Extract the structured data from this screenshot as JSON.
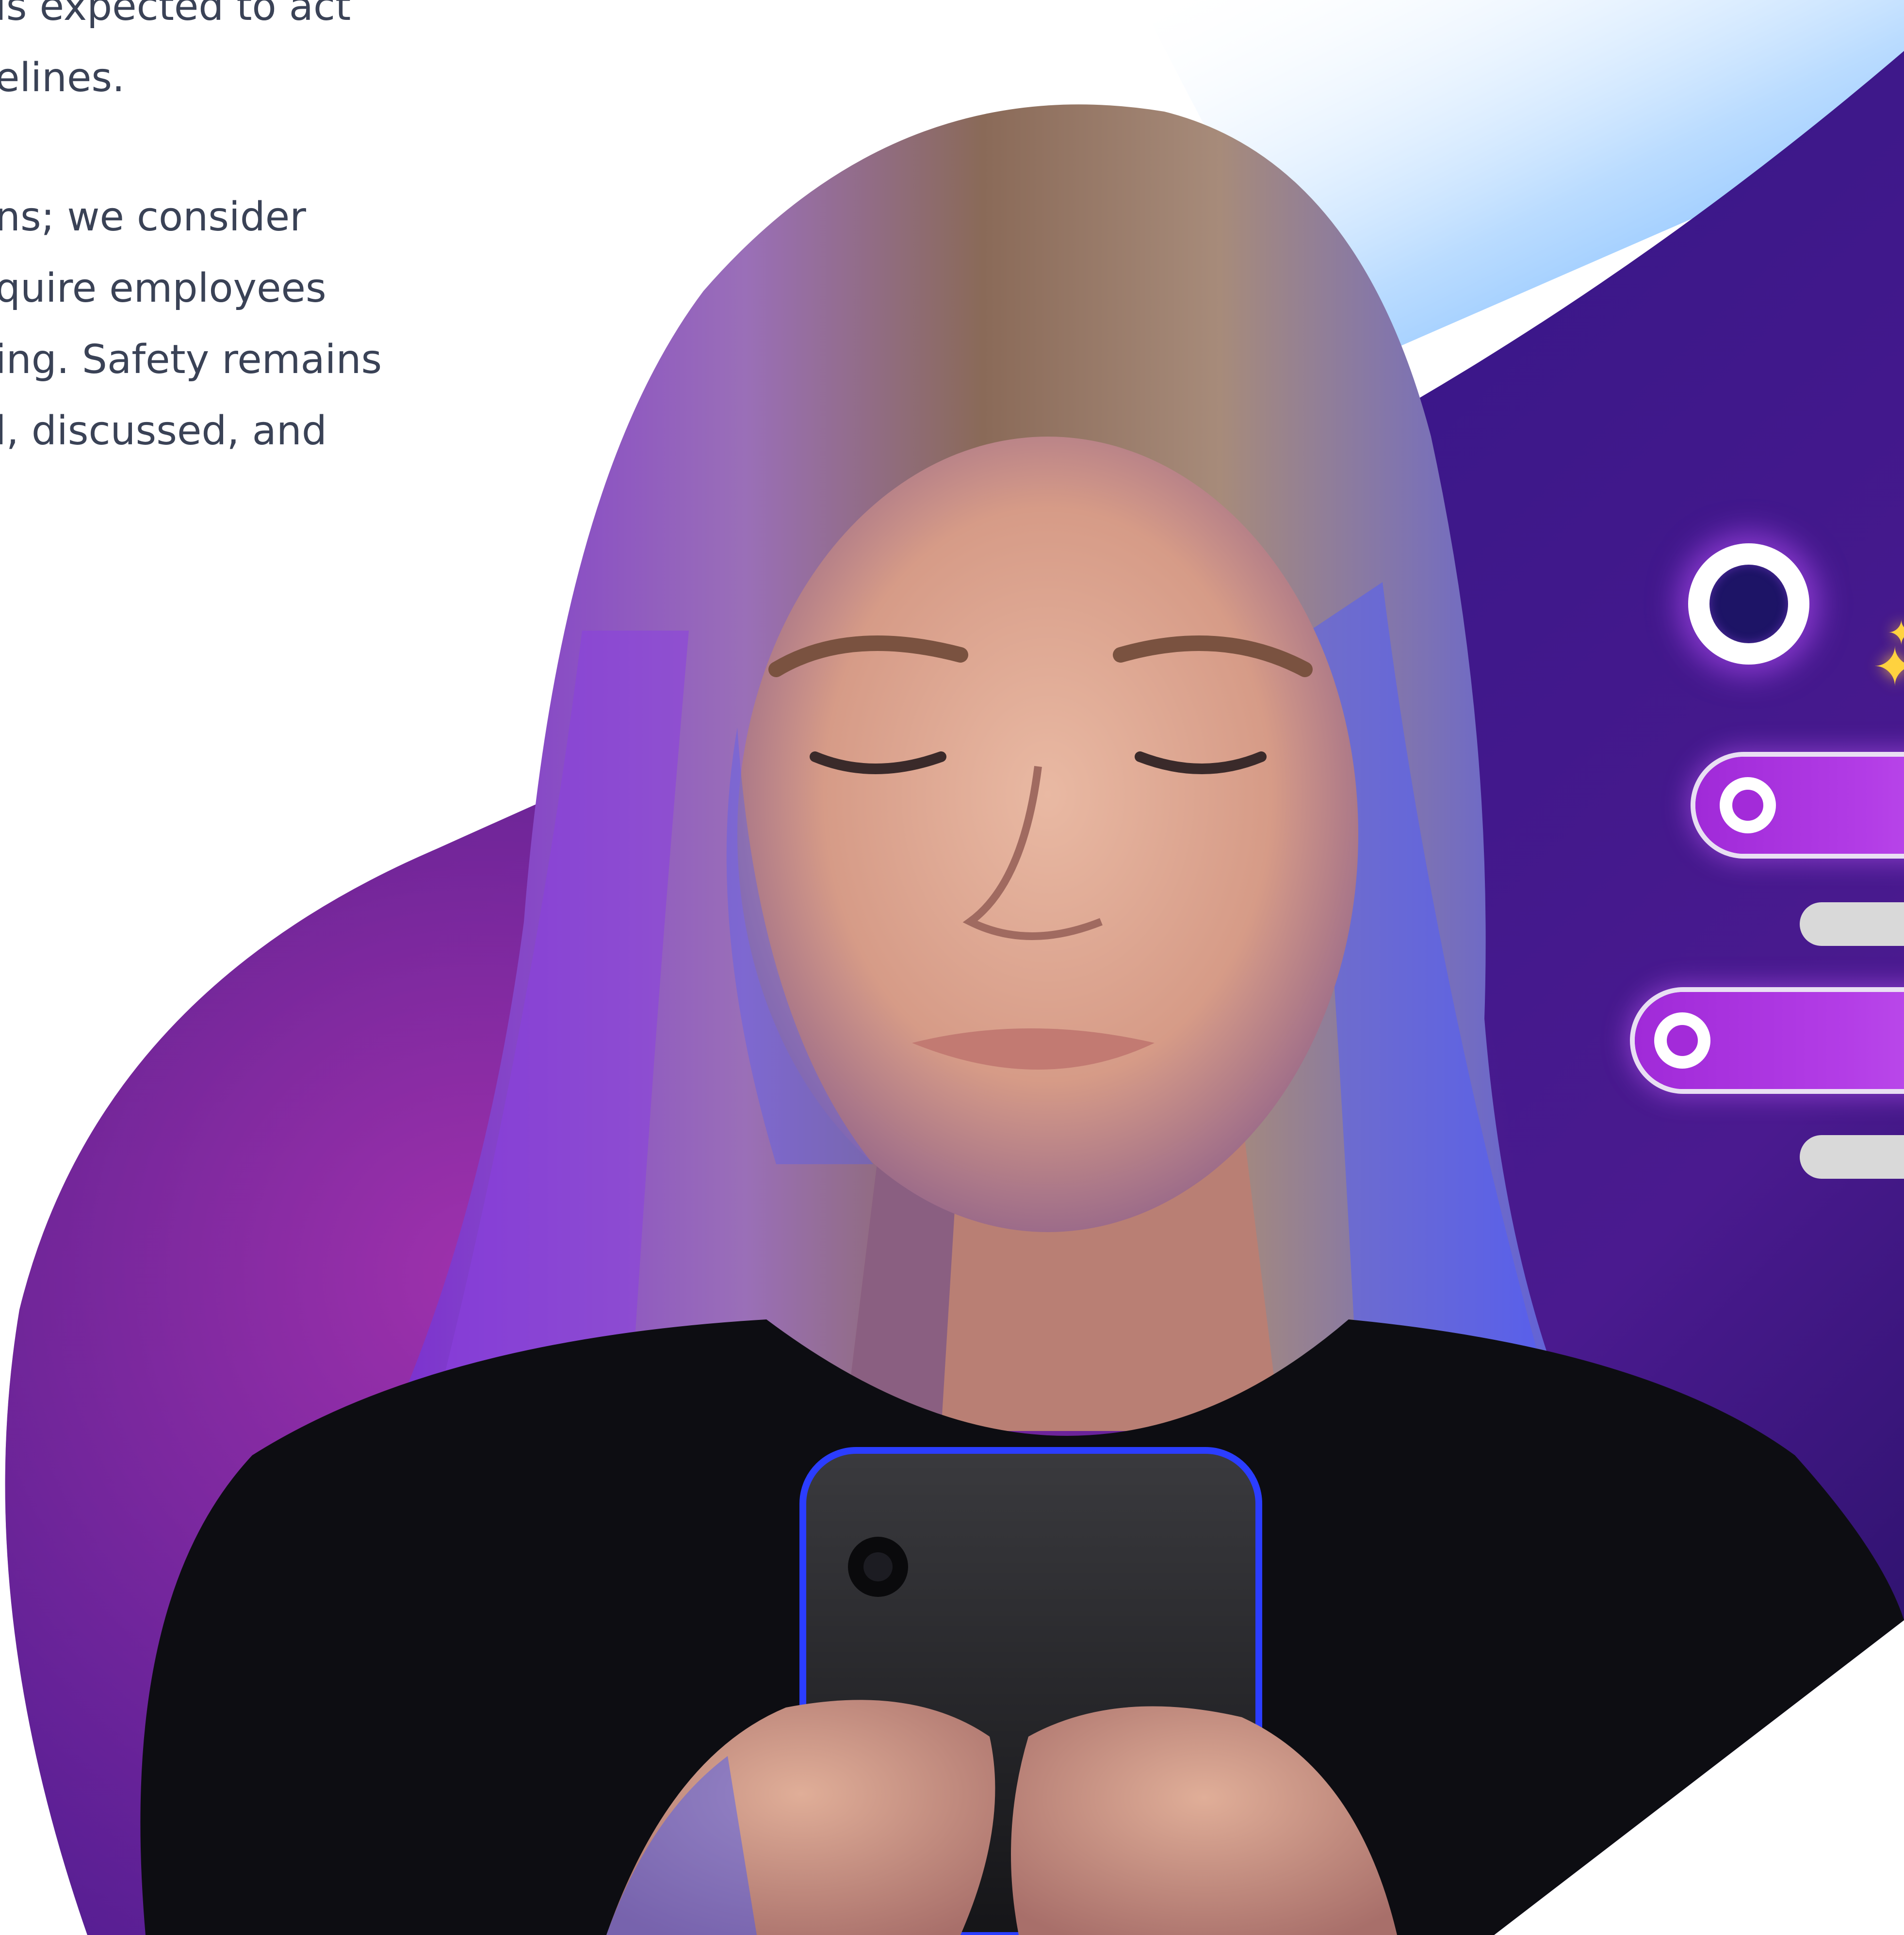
{
  "body_text": {
    "lines": [
      "is expected to act",
      "elines.",
      "ns; we consider",
      "quire employees",
      "ing. Safety remains",
      "l, discussed, and"
    ]
  },
  "hero_image": {
    "subject": "woman looking down at smartphone",
    "background_colors": {
      "blob_dark": "#1f0f63",
      "blob_purple": "#6a1fa8",
      "glow_blue": "#6fb6ff",
      "accent_magenta": "#b33de6"
    }
  },
  "overlay_ui": {
    "icons": [
      "ring-icon",
      "sparkle-icon",
      "toggle-dot-icon"
    ],
    "accent": "#b33de6",
    "bar_color": "#d9d9d9"
  }
}
